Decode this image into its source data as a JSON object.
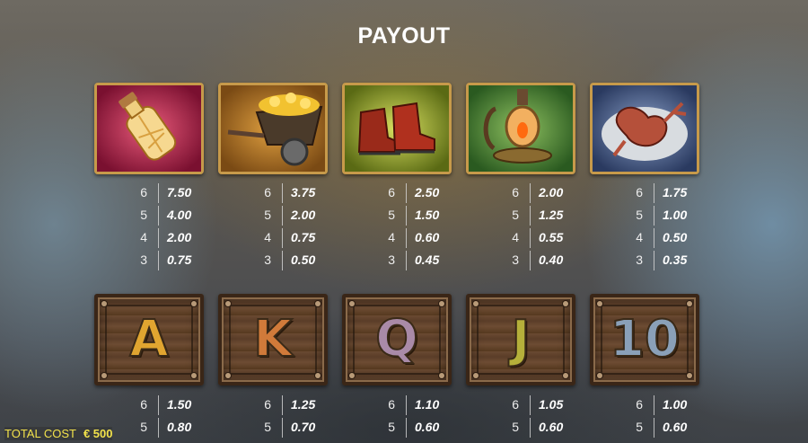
{
  "title": "PAYOUT",
  "premium_symbols": [
    {
      "icon": "potion-bottle-icon",
      "bg": "#b0284f",
      "pays": [
        {
          "count": "6",
          "value": "7.50"
        },
        {
          "count": "5",
          "value": "4.00"
        },
        {
          "count": "4",
          "value": "2.00"
        },
        {
          "count": "3",
          "value": "0.75"
        }
      ]
    },
    {
      "icon": "wheelbarrow-gold-icon",
      "bg": "#b8702a",
      "pays": [
        {
          "count": "6",
          "value": "3.75"
        },
        {
          "count": "5",
          "value": "2.00"
        },
        {
          "count": "4",
          "value": "0.75"
        },
        {
          "count": "3",
          "value": "0.50"
        }
      ]
    },
    {
      "icon": "boots-icon",
      "bg": "#8fa126",
      "pays": [
        {
          "count": "6",
          "value": "2.50"
        },
        {
          "count": "5",
          "value": "1.50"
        },
        {
          "count": "4",
          "value": "0.60"
        },
        {
          "count": "3",
          "value": "0.45"
        }
      ]
    },
    {
      "icon": "lantern-icon",
      "bg": "#4f8a3a",
      "pays": [
        {
          "count": "6",
          "value": "2.00"
        },
        {
          "count": "5",
          "value": "1.25"
        },
        {
          "count": "4",
          "value": "0.55"
        },
        {
          "count": "3",
          "value": "0.40"
        }
      ]
    },
    {
      "icon": "mandrake-root-icon",
      "bg": "#4f6fa0",
      "pays": [
        {
          "count": "6",
          "value": "1.75"
        },
        {
          "count": "5",
          "value": "1.00"
        },
        {
          "count": "4",
          "value": "0.50"
        },
        {
          "count": "3",
          "value": "0.35"
        }
      ]
    }
  ],
  "card_symbols": [
    {
      "letter": "A",
      "color": "#e0a530",
      "pays": [
        {
          "count": "6",
          "value": "1.50"
        },
        {
          "count": "5",
          "value": "0.80"
        }
      ]
    },
    {
      "letter": "K",
      "color": "#d07a3a",
      "pays": [
        {
          "count": "6",
          "value": "1.25"
        },
        {
          "count": "5",
          "value": "0.70"
        }
      ]
    },
    {
      "letter": "Q",
      "color": "#a98aa8",
      "pays": [
        {
          "count": "6",
          "value": "1.10"
        },
        {
          "count": "5",
          "value": "0.60"
        }
      ]
    },
    {
      "letter": "J",
      "color": "#b5b03a",
      "pays": [
        {
          "count": "6",
          "value": "1.05"
        },
        {
          "count": "5",
          "value": "0.60"
        }
      ]
    },
    {
      "letter": "10",
      "color": "#8aa0b8",
      "pays": [
        {
          "count": "6",
          "value": "1.00"
        },
        {
          "count": "5",
          "value": "0.60"
        }
      ]
    }
  ],
  "footer": {
    "total_cost_label": "TOTAL COST",
    "total_cost_value": "€ 500"
  }
}
